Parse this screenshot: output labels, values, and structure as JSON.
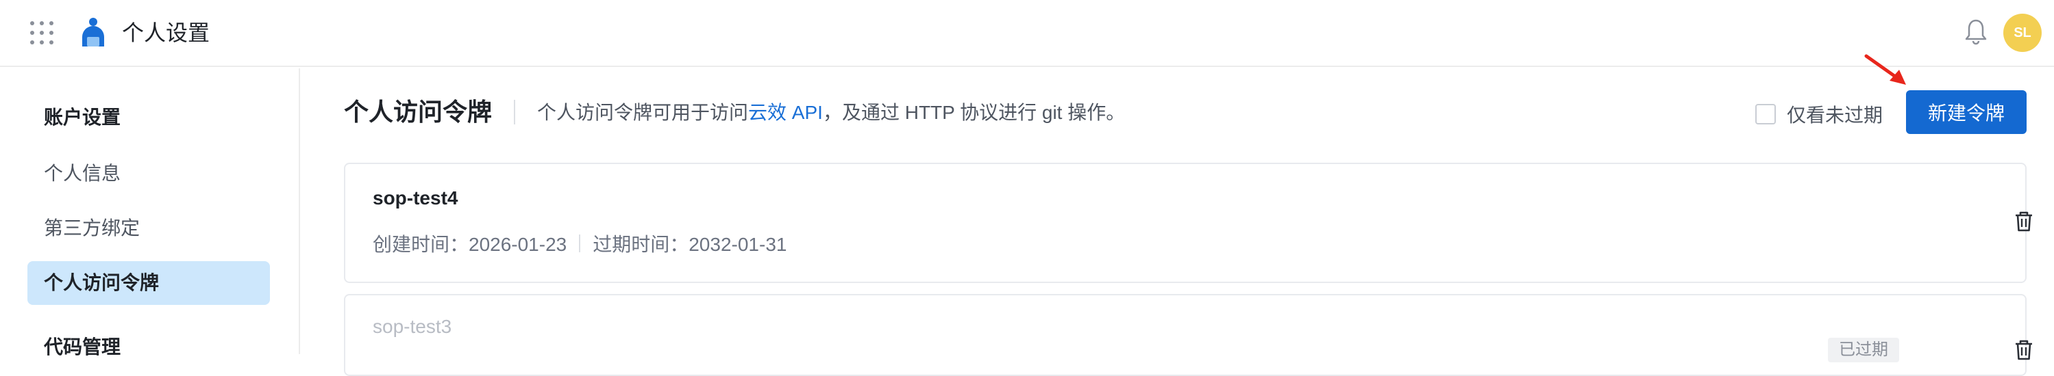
{
  "header": {
    "app_title": "个人设置",
    "avatar_initials": "SL",
    "icons": {
      "apps": "apps-grid-icon",
      "logo": "logo-icon",
      "notifications": "bell-icon"
    }
  },
  "sidebar": {
    "section_account": "账户设置",
    "items": [
      {
        "label": "个人信息",
        "active": false
      },
      {
        "label": "第三方绑定",
        "active": false
      },
      {
        "label": "个人访问令牌",
        "active": true
      }
    ],
    "section_code": "代码管理"
  },
  "main": {
    "title": "个人访问令牌",
    "description_prefix": "个人访问令牌可用于访问",
    "description_link": "云效 API",
    "description_suffix": "，及通过 HTTP 协议进行 git 操作。",
    "filter_label": "仅看未过期",
    "filter_checked": false,
    "new_token_button": "新建令牌"
  },
  "tokens": [
    {
      "name": "sop-test4",
      "created_label": "创建时间：2026-01-23",
      "expires_label": "过期时间：2032-01-31",
      "expired": false
    },
    {
      "name": "sop-test3",
      "badge": "已过期",
      "expired": true
    }
  ],
  "colors": {
    "accent": "#1469d1",
    "link": "#1a6fd6",
    "active_nav": "#cde7fc",
    "avatar": "#f3cf52",
    "annotation_arrow": "#e8261c"
  }
}
